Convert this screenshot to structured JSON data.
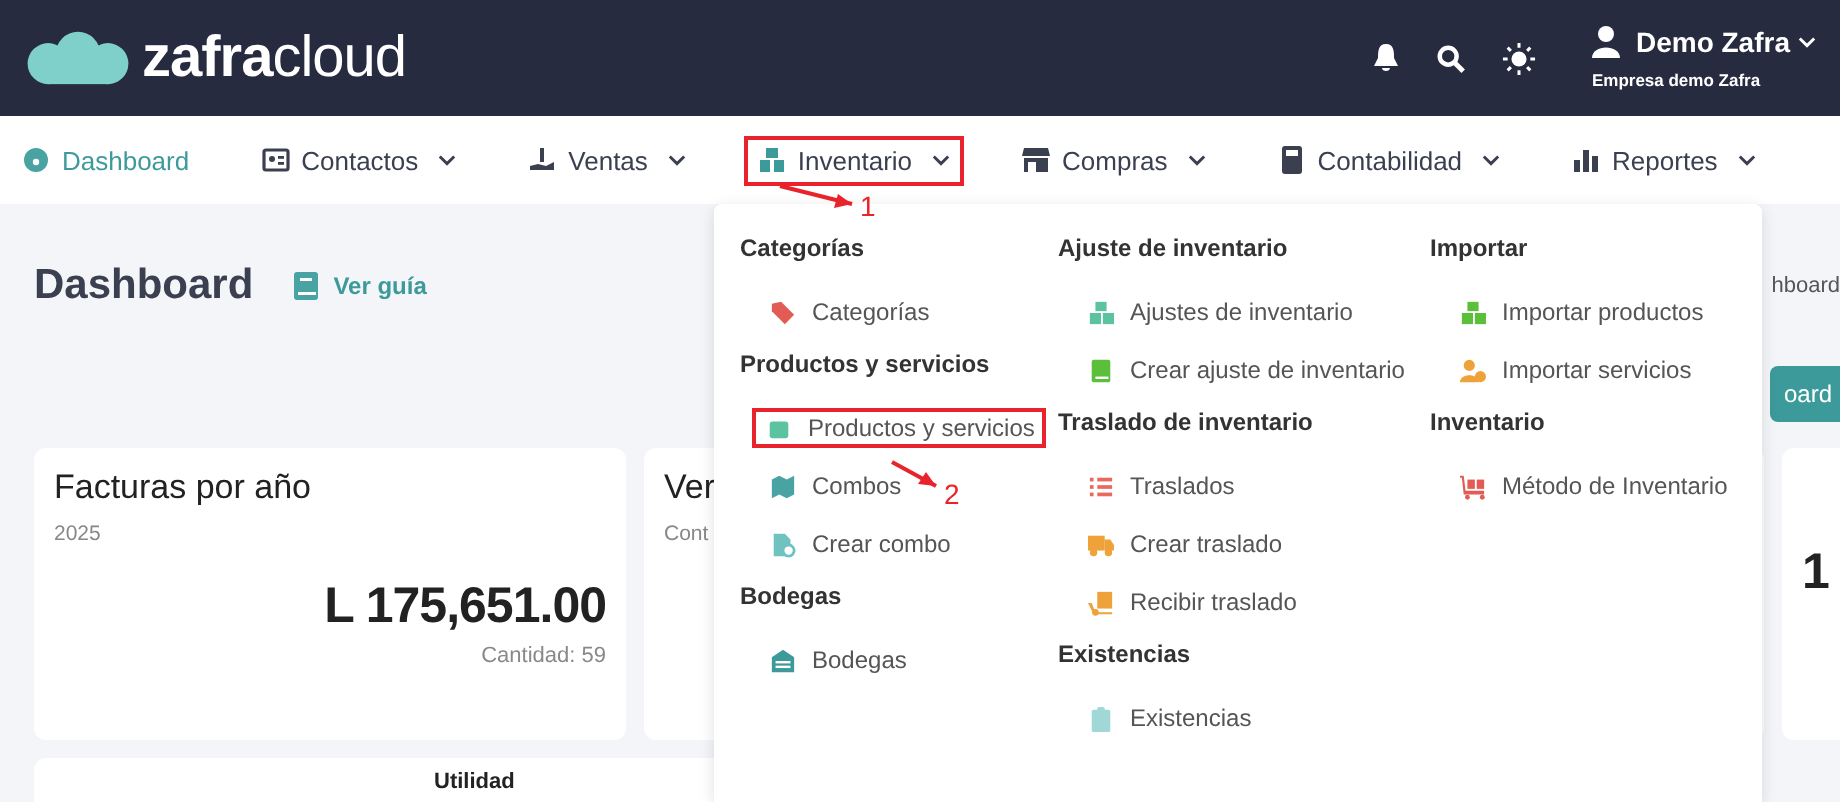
{
  "header": {
    "logo": {
      "bold": "zafra",
      "light": "cloud"
    },
    "user": {
      "name": "Demo Zafra",
      "company": "Empresa demo Zafra"
    }
  },
  "nav": [
    {
      "label": "Dashboard",
      "kind": "dashboard",
      "selected": true,
      "dropdown": false,
      "highlighted": false
    },
    {
      "label": "Contactos",
      "kind": "contacts",
      "selected": false,
      "dropdown": true,
      "highlighted": false
    },
    {
      "label": "Ventas",
      "kind": "sales",
      "selected": false,
      "dropdown": true,
      "highlighted": false
    },
    {
      "label": "Inventario",
      "kind": "inventory",
      "selected": false,
      "dropdown": true,
      "highlighted": true
    },
    {
      "label": "Compras",
      "kind": "store",
      "selected": false,
      "dropdown": true,
      "highlighted": false
    },
    {
      "label": "Contabilidad",
      "kind": "calculator",
      "selected": false,
      "dropdown": true,
      "highlighted": false
    },
    {
      "label": "Reportes",
      "kind": "chart",
      "selected": false,
      "dropdown": true,
      "highlighted": false
    }
  ],
  "page": {
    "title": "Dashboard",
    "guide_link": "Ver guía",
    "breadcrumb": "hboard",
    "button": "oard",
    "cards": [
      {
        "title": "Facturas por año",
        "subtitle": "2025",
        "amount": "L 175,651.00",
        "count": "Cantidad: 59"
      },
      {
        "title": "Ver",
        "subtitle": "Cont"
      },
      {
        "amount": "1"
      }
    ],
    "bottom_card": {
      "title": "Utilidad"
    }
  },
  "menu": {
    "columns": [
      {
        "sections": [
          {
            "heading": "Categorías",
            "items": [
              {
                "label": "Categorías",
                "kind": "tag",
                "highlighted": false
              }
            ]
          },
          {
            "heading": "Productos y servicios",
            "items": [
              {
                "label": "Productos y servicios",
                "kind": "box",
                "highlighted": true
              },
              {
                "label": "Combos",
                "kind": "map",
                "highlighted": false
              },
              {
                "label": "Crear combo",
                "kind": "file",
                "highlighted": false
              }
            ]
          },
          {
            "heading": "Bodegas",
            "items": [
              {
                "label": "Bodegas",
                "kind": "warehouse",
                "highlighted": false
              }
            ]
          }
        ]
      },
      {
        "sections": [
          {
            "heading": "Ajuste de inventario",
            "items": [
              {
                "label": "Ajustes de inventario",
                "kind": "boxes",
                "highlighted": false
              },
              {
                "label": "Crear ajuste de inventario",
                "kind": "book",
                "highlighted": false
              }
            ]
          },
          {
            "heading": "Traslado de inventario",
            "items": [
              {
                "label": "Traslados",
                "kind": "list",
                "highlighted": false
              },
              {
                "label": "Crear traslado",
                "kind": "truck",
                "highlighted": false
              },
              {
                "label": "Recibir traslado",
                "kind": "dolly",
                "highlighted": false
              }
            ]
          },
          {
            "heading": "Existencias",
            "items": [
              {
                "label": "Existencias",
                "kind": "clipboard",
                "highlighted": false
              }
            ]
          }
        ]
      },
      {
        "sections": [
          {
            "heading": "Importar",
            "items": [
              {
                "label": "Importar productos",
                "kind": "boxes-green",
                "highlighted": false
              },
              {
                "label": "Importar servicios",
                "kind": "user-gear",
                "highlighted": false
              }
            ]
          },
          {
            "heading": "Inventario",
            "items": [
              {
                "label": "Método de Inventario",
                "kind": "cart",
                "highlighted": false
              }
            ]
          }
        ]
      }
    ]
  },
  "annotations": [
    {
      "label": "1"
    },
    {
      "label": "2"
    }
  ]
}
